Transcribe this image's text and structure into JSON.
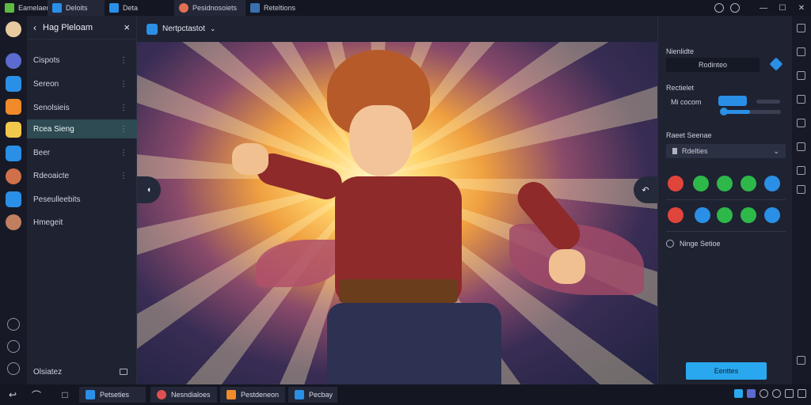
{
  "titlebar": {
    "tabs": [
      {
        "label": "Eamelaen",
        "icon": "app-green-icon",
        "color": "#5dbb3f"
      },
      {
        "label": "Deloits",
        "icon": "app-blue-icon",
        "color": "#2a8fe6"
      },
      {
        "label": "Deta",
        "icon": "app-blue-icon",
        "color": "#2a8fe6"
      },
      {
        "label": "Pesidnosoiets",
        "icon": "avatar-icon",
        "color": "#e07050"
      },
      {
        "label": "Reteltions",
        "icon": "app-dark-icon",
        "color": "#3a6fb0"
      }
    ],
    "window_controls": [
      "—",
      "☐",
      "✕"
    ]
  },
  "sidebar": {
    "title": "Hag Pleloam",
    "items": [
      {
        "label": "Cispots",
        "icon": "globe-icon",
        "color": "#5b6bd0"
      },
      {
        "label": "Sereon",
        "icon": "screen-icon",
        "color": "#2a8fe6"
      },
      {
        "label": "Senolsieis",
        "icon": "chart-icon",
        "color": "#f08a2a"
      },
      {
        "label": "Rcea Sieng",
        "icon": "folder-icon",
        "color": "#f2c94c"
      },
      {
        "label": "Beer",
        "icon": "box-icon",
        "color": "#2a8fe6"
      },
      {
        "label": "Rdeoaicte",
        "icon": "character-icon",
        "color": "#d0704a"
      },
      {
        "label": "Peseulleebits",
        "icon": "doc-icon",
        "color": "#2a8fe6"
      },
      {
        "label": "Hmegeit",
        "icon": "face-icon",
        "color": "#c08060"
      }
    ],
    "footer_label": "Olsiatez"
  },
  "main": {
    "header_label": "Nertpctastot",
    "nav_left": "◖",
    "nav_right": "↶"
  },
  "rpanel": {
    "label_1": "Nienlidte",
    "field_1": "Rodinteo",
    "label_2": "Rectielet",
    "label_3": "Mi cocom",
    "label_4": "Raeet Seenae",
    "select_value": "Rdelties",
    "toggle_label": "Ninge Setioe",
    "primary_button": "Eenttes"
  },
  "taskbar": {
    "apps": [
      {
        "label": "Petseties",
        "color": "#2a8fe6"
      },
      {
        "label": "Nesndialoes",
        "color": "#e05050"
      },
      {
        "label": "Pestdeneon",
        "color": "#f08a2a"
      },
      {
        "label": "Pecbay",
        "color": "#2a8fe6"
      }
    ]
  }
}
